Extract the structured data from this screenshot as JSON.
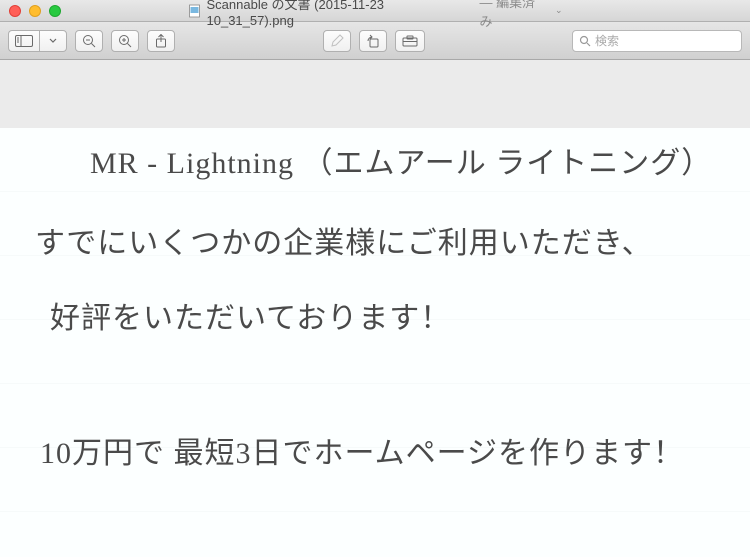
{
  "titlebar": {
    "filename": "Scannable の文書 (2015-11-23 10_31_57).png",
    "status": "編集済み",
    "chevron": "⌄"
  },
  "toolbar": {
    "search_placeholder": "検索"
  },
  "document": {
    "line1": "MR - Lightning （エムアール ライトニング）",
    "line2": "すでにいくつかの企業様にご利用いただき、",
    "line3": "好評をいただいております！",
    "line4": "10万円で 最短3日でホームページを作ります！"
  }
}
